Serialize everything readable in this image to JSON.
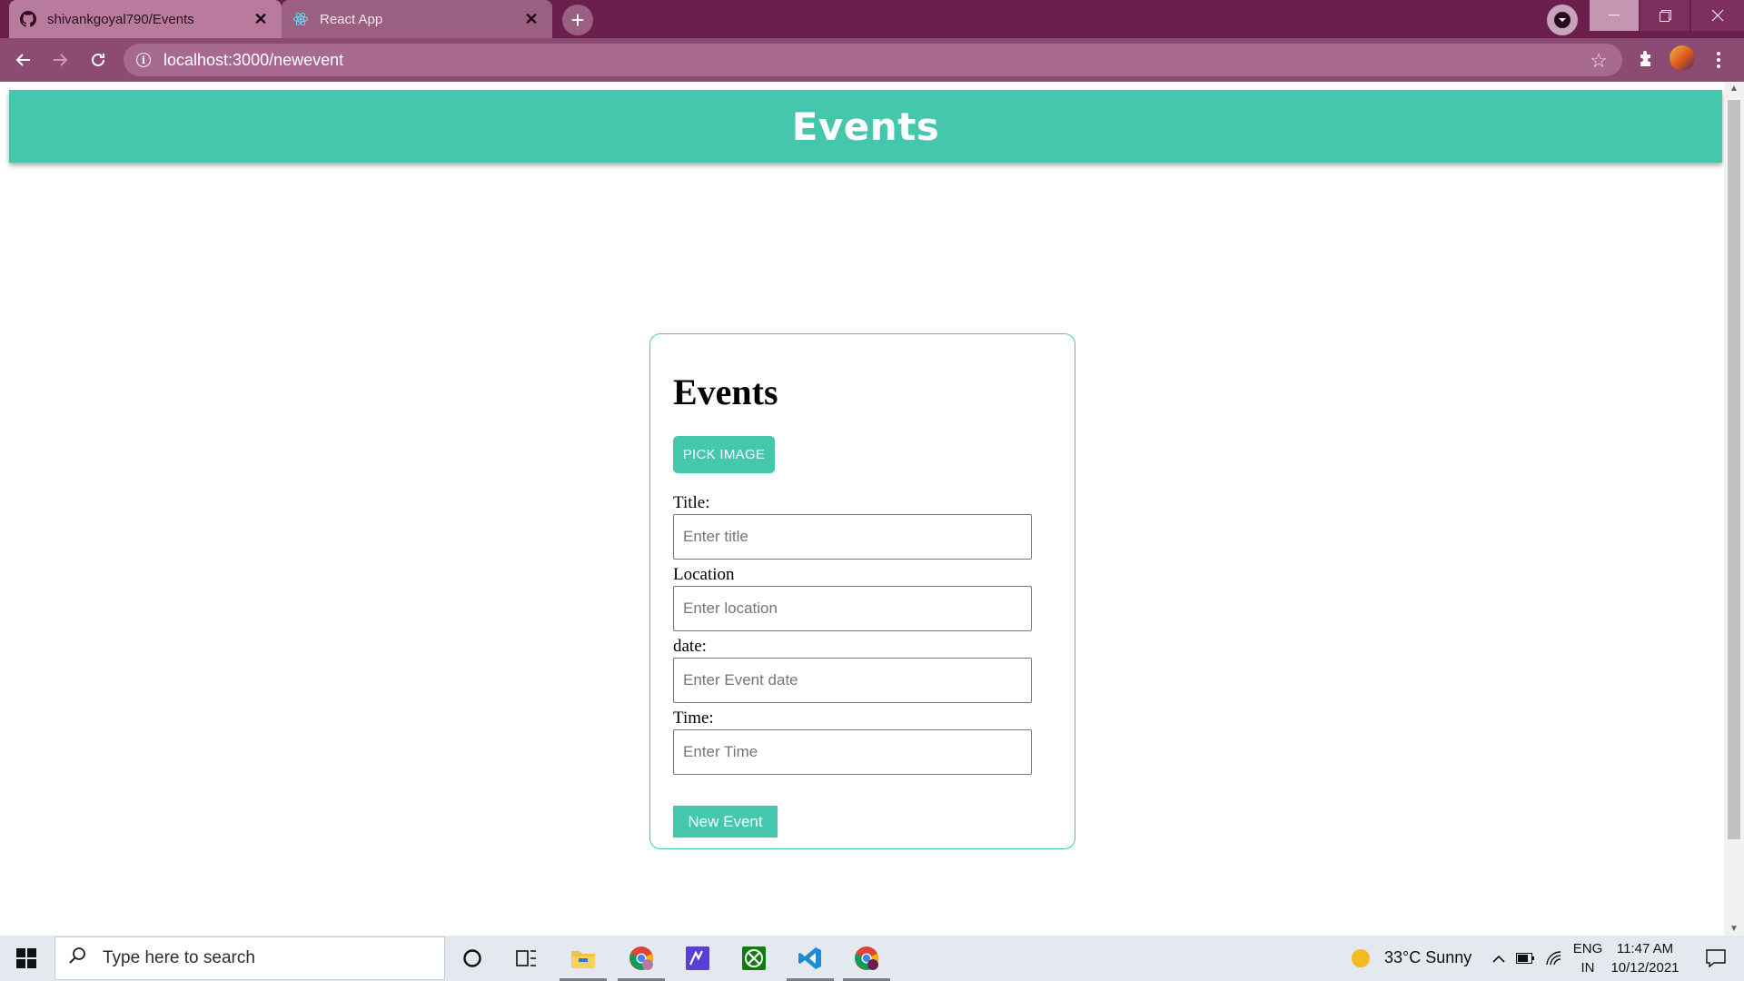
{
  "browser": {
    "tabs": [
      {
        "title": "shivankgoyal790/Events",
        "icon": "github-icon",
        "active": true
      },
      {
        "title": "React App",
        "icon": "react-icon",
        "active": false
      }
    ],
    "url": "localhost:3000/newevent",
    "new_tab_symbol": "+",
    "close_symbol": "✕"
  },
  "app": {
    "header_title": "Events"
  },
  "form": {
    "heading": "Events",
    "pick_image_label": "PICK IMAGE",
    "fields": [
      {
        "label": "Title:",
        "placeholder": "Enter title"
      },
      {
        "label": "Location",
        "placeholder": "Enter location"
      },
      {
        "label": "date:",
        "placeholder": "Enter Event date"
      },
      {
        "label": "Time:",
        "placeholder": "Enter Time"
      }
    ],
    "submit_label": "New Event"
  },
  "taskbar": {
    "search_placeholder": "Type here to search",
    "weather": "33°C  Sunny",
    "language": "ENG",
    "region": "IN",
    "time": "11:47 AM",
    "date": "10/12/2021"
  },
  "colors": {
    "accent": "#45c7ae",
    "browser_frame": "#6b1f4d",
    "toolbar": "#8c4b73"
  }
}
